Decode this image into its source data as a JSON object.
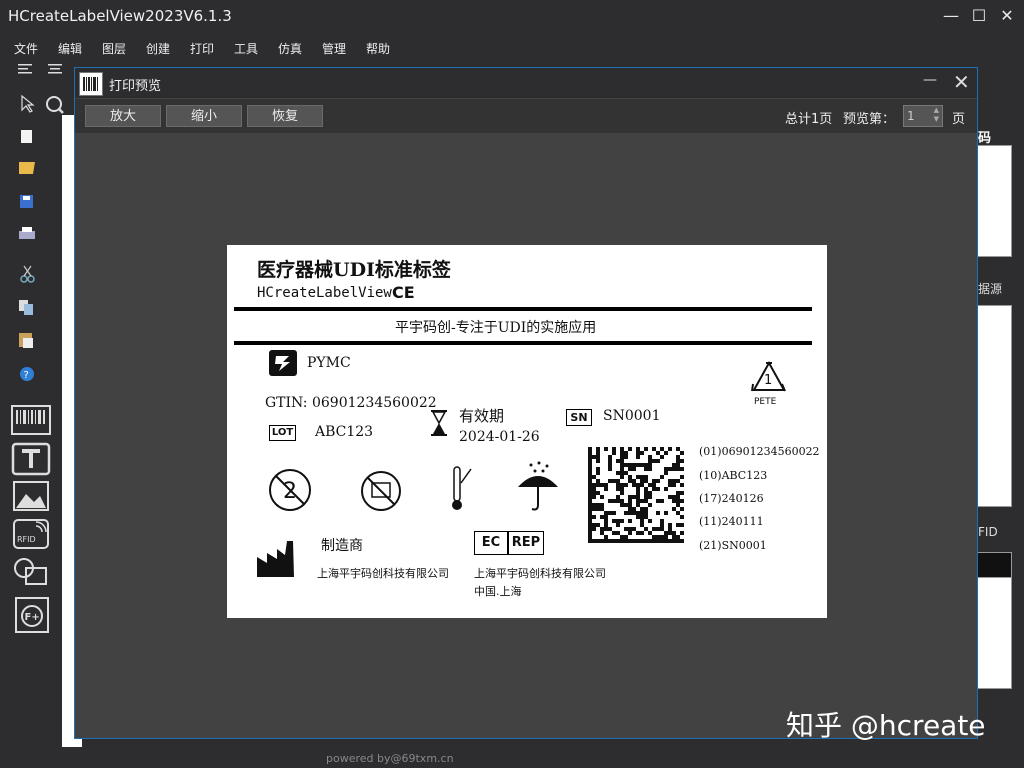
{
  "app": {
    "title": "HCreateLabelView2023V6.1.3",
    "menu": [
      "文件",
      "编辑",
      "图层",
      "创建",
      "打印",
      "工具",
      "仿真",
      "管理",
      "帮助"
    ]
  },
  "right_panel": {
    "section1": "码",
    "section2": "据源",
    "section3": "FID"
  },
  "footer": {
    "powered": "powered by@69txm.cn",
    "watermark": "知乎 @hcreate"
  },
  "preview": {
    "title": "打印预览",
    "buttons": {
      "zoom_in": "放大",
      "zoom_out": "缩小",
      "reset": "恢复"
    },
    "total_pages": "总计1页",
    "preview_label": "预览第：",
    "page_value": "1",
    "page_unit": "页"
  },
  "label": {
    "title": "医疗器械UDI标准标签",
    "brand": "HCreateLabelView",
    "ce_mark": "CE",
    "slogan": "平宇码创-专注于UDI的实施应用",
    "company_short": "PYMC",
    "gtin": "GTIN: 06901234560022",
    "lot_box": "LOT",
    "lot_value": "ABC123",
    "expiry_label": "有效期",
    "expiry_value": "2024-01-26",
    "sn_box": "SN",
    "sn_value": "SN0001",
    "recycle_number": "1",
    "recycle_text": "PETE",
    "manufacturer_label": "制造商",
    "manufacturer_name": "上海平宇码创科技有限公司",
    "ec_box": "EC",
    "rep_box": "REP",
    "rep_name": "上海平宇码创科技有限公司",
    "rep_location": "中国.上海",
    "hri": [
      "(01)06901234560022",
      "(10)ABC123",
      "(17)240126",
      "(11)240111",
      "(21)SN0001"
    ]
  }
}
